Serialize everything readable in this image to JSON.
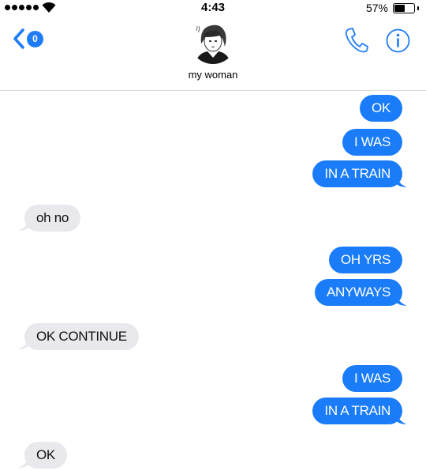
{
  "status_bar": {
    "time": "4:43",
    "battery_percent": "57%",
    "battery_level": 0.57,
    "signal_bars": 5,
    "wifi": "wifi-icon"
  },
  "header": {
    "unread_count": "0",
    "contact_name": "my woman",
    "icons": [
      "back-chevron-icon",
      "phone-icon",
      "info-icon"
    ],
    "accent_color": "#1a7cf9"
  },
  "messages": [
    {
      "text": "OK",
      "type": "sent"
    },
    {
      "text": "I WAS",
      "type": "sent"
    },
    {
      "text": "IN A TRAIN",
      "type": "sent"
    },
    {
      "text": "oh no",
      "type": "received"
    },
    {
      "text": "OH YRS",
      "type": "sent"
    },
    {
      "text": "ANYWAYS",
      "type": "sent"
    },
    {
      "text": "OK CONTINUE",
      "type": "received"
    },
    {
      "text": "I WAS",
      "type": "sent"
    },
    {
      "text": "IN A TRAIN",
      "type": "sent"
    },
    {
      "text": "OK",
      "type": "received"
    }
  ],
  "colors": {
    "sent_bubble": "#1a7cf9",
    "received_bubble": "#e8e8ed"
  }
}
